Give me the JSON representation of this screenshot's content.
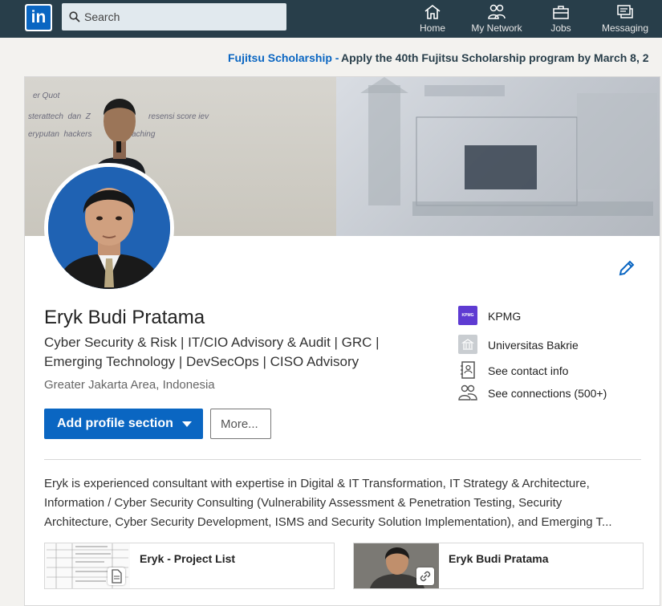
{
  "nav": {
    "search_placeholder": "Search",
    "items": [
      {
        "label": "Home",
        "icon": "home-icon"
      },
      {
        "label": "My Network",
        "icon": "network-icon"
      },
      {
        "label": "Jobs",
        "icon": "jobs-icon"
      },
      {
        "label": "Messaging",
        "icon": "messaging-icon"
      }
    ]
  },
  "ad": {
    "brand": "Fujitsu Scholarship -",
    "text": "Apply the 40th Fujitsu Scholarship program by March 8, 2"
  },
  "profile": {
    "name": "Eryk Budi Pratama",
    "headline_line1": "Cyber Security & Risk | IT/CIO Advisory & Audit | GRC |",
    "headline_line2": "Emerging Technology | DevSecOps | CISO Advisory",
    "location": "Greater Jakarta Area, Indonesia",
    "add_section_label": "Add profile section",
    "more_label": "More...",
    "side": [
      {
        "label": "KPMG",
        "icon": "kpmg-logo-icon",
        "logo_text": "KPMG"
      },
      {
        "label": "Universitas Bakrie",
        "icon": "school-icon"
      },
      {
        "label": "See contact info",
        "icon": "contact-card-icon"
      },
      {
        "label": "See connections (500+)",
        "icon": "connections-icon"
      }
    ],
    "summary": [
      "Eryk is experienced consultant with expertise in Digital & IT Transformation, IT Strategy & Architecture,",
      "Information / Cyber Security Consulting (Vulnerability Assessment & Penetration Testing, Security",
      "Architecture, Cyber Security Development, ISMS and Security Solution Implementation), and Emerging T..."
    ],
    "media": [
      {
        "title": "Eryk - Project List",
        "icon": "document-icon"
      },
      {
        "title": "Eryk Budi Pratama",
        "icon": "link-icon"
      }
    ]
  },
  "colors": {
    "nav_bg": "#283e4a",
    "accent": "#0a66c2",
    "kpmg": "#5e3bd2"
  }
}
